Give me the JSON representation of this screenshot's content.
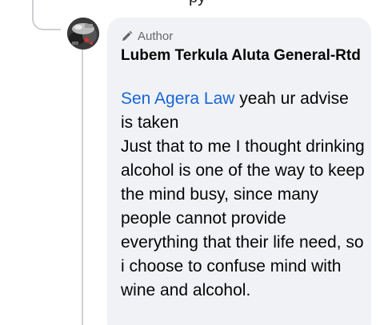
{
  "top_fragment": "py",
  "comment": {
    "badge_label": "Author",
    "author_name": "Lubem Terkula Aluta General-Rtd",
    "mention": "Sen Agera Law",
    "first_line_text": " yeah ur advise is taken",
    "paragraph": "Just that to me I thought drinking alcohol is one of the way to keep the mind busy, since many people cannot provide everything that their life need, so i choose to confuse mind with wine and alcohol."
  },
  "colors": {
    "bubble_bg": "#f0f2f5",
    "mention": "#1866d4",
    "meta_gray": "#65676b",
    "thread_line": "#ced0d4"
  },
  "icons": {
    "badge_icon": "pencil-icon",
    "avatar": "user-avatar"
  }
}
